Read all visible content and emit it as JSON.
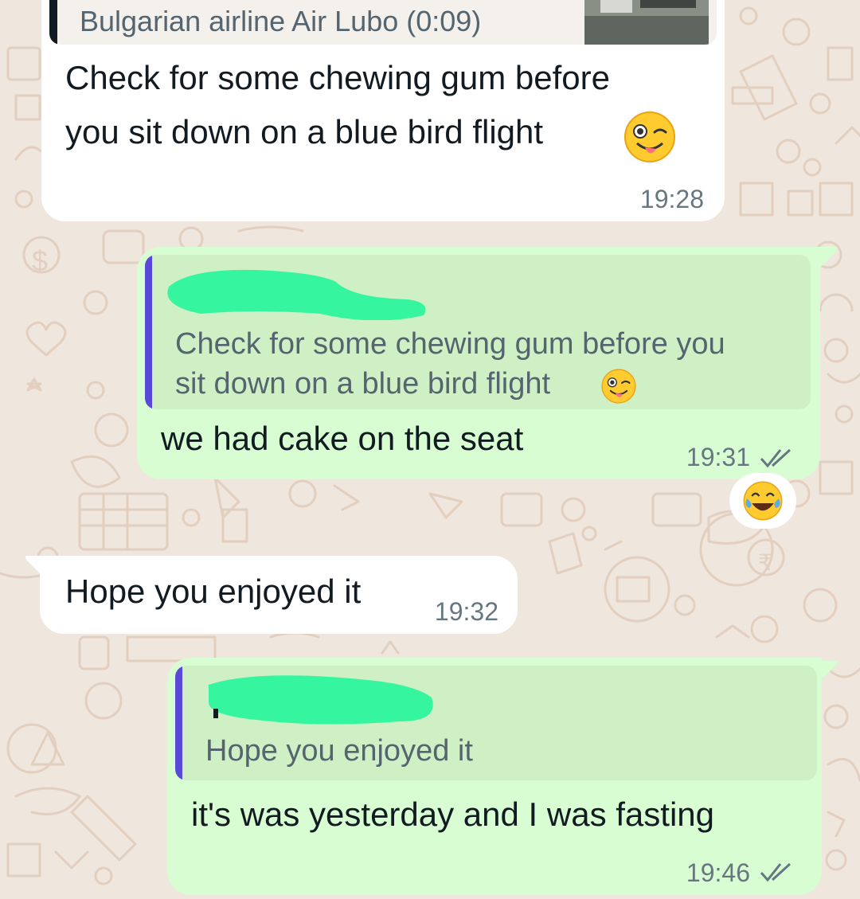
{
  "colors": {
    "wallpaper": "#efe6dd",
    "doodle": "#e3cfbf",
    "incoming_bubble": "#ffffff",
    "outgoing_bubble": "#d9fdd3",
    "quote_background": "#cff0c5",
    "quote_bar": "#5a48d8",
    "tick_color": "#667781",
    "redaction": "#35f69f"
  },
  "messages": {
    "m1": {
      "link_preview_title": "Bulgarian airline Air Lubo (0:09)",
      "text_line1": "Check for some chewing gum before",
      "text_line2": "you sit down on a blue bird flight",
      "emoji": "winking-face-with-tongue-icon",
      "time": "19:28"
    },
    "m2": {
      "quoted_line1": "Check for some chewing gum before you",
      "quoted_line2": "sit down on a blue bird flight",
      "quoted_emoji": "winking-face-with-tongue-icon",
      "text": "we had cake on the seat",
      "time": "19:31",
      "status": "read-double-tick-icon",
      "reaction": "face-with-tears-of-joy-icon"
    },
    "m3": {
      "text": "Hope you enjoyed it",
      "time": "19:32"
    },
    "m4": {
      "quoted_text": "Hope you enjoyed it",
      "text": "it's was yesterday and I was fasting",
      "time": "19:46",
      "status": "read-double-tick-icon"
    }
  }
}
